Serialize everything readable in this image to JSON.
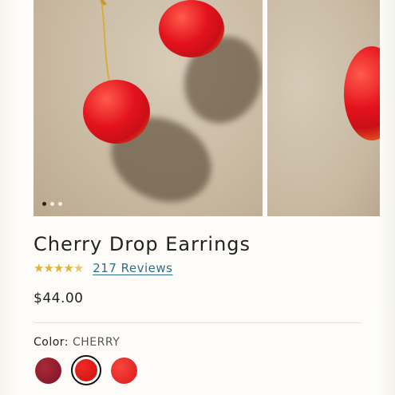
{
  "product": {
    "title": "Cherry Drop Earrings",
    "rating": 4.5,
    "reviews_label": "217 Reviews",
    "price": "$44.00"
  },
  "color": {
    "label": "Color:",
    "selected": "CHERRY",
    "swatches": [
      {
        "name": "dark-red",
        "color": "#8a1a2b"
      },
      {
        "name": "cherry",
        "color": "#d91a1a"
      },
      {
        "name": "red",
        "color": "#e5201f"
      }
    ]
  },
  "gallery": {
    "dot_count": 3,
    "active_dot": 1
  },
  "colors": {
    "star": "#e0b33c",
    "link": "#2f6f86",
    "background": "#fdfcf8"
  }
}
